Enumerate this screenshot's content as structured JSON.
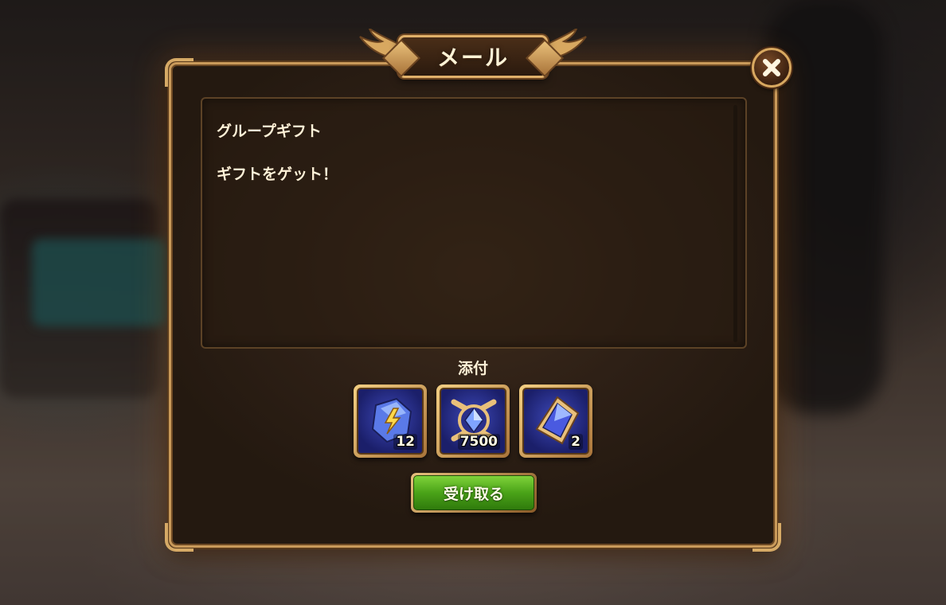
{
  "dialog": {
    "title": "メール",
    "close_icon": "close-icon"
  },
  "message": {
    "title": "グループギフト",
    "body": "ギフトをゲット！"
  },
  "attachments": {
    "label": "添付",
    "items": [
      {
        "icon": "lightning-crystal-icon",
        "quantity": "12"
      },
      {
        "icon": "gem-emblem-icon",
        "quantity": "7500"
      },
      {
        "icon": "blue-diamond-icon",
        "quantity": "2"
      }
    ]
  },
  "actions": {
    "claim_label": "受け取る"
  },
  "colors": {
    "panel_border": "#c99a5a",
    "text": "#fff2d8",
    "claim_button": "#4aa318"
  }
}
